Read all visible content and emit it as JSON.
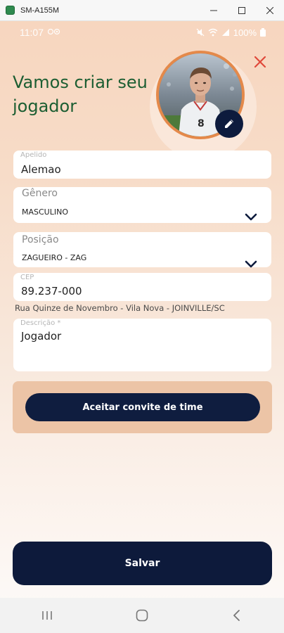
{
  "window": {
    "title": "SM-A155M"
  },
  "status_bar": {
    "time": "11:07",
    "battery": "100%"
  },
  "header": {
    "title": "Vamos criar seu jogador"
  },
  "avatar": {
    "jersey_number": "8"
  },
  "form": {
    "apelido": {
      "label": "Apelido",
      "value": "Alemao"
    },
    "genero": {
      "label": "Gênero",
      "value": "MASCULINO"
    },
    "posicao": {
      "label": "Posição",
      "value": "ZAGUEIRO - ZAG"
    },
    "cep": {
      "label": "CEP",
      "value": "89.237-000"
    },
    "address": "Rua Quinze de Novembro - Vila Nova - JOINVILLE/SC",
    "descricao": {
      "label": "Descrição *",
      "value": "Jogador"
    }
  },
  "buttons": {
    "invite": "Aceitar convite de time",
    "save": "Salvar"
  },
  "colors": {
    "title": "#1c5e32",
    "primary": "#0d1a3b",
    "avatar_ring": "#e4894a",
    "close": "#e0493a",
    "invite_card": "#ecc4a6"
  }
}
